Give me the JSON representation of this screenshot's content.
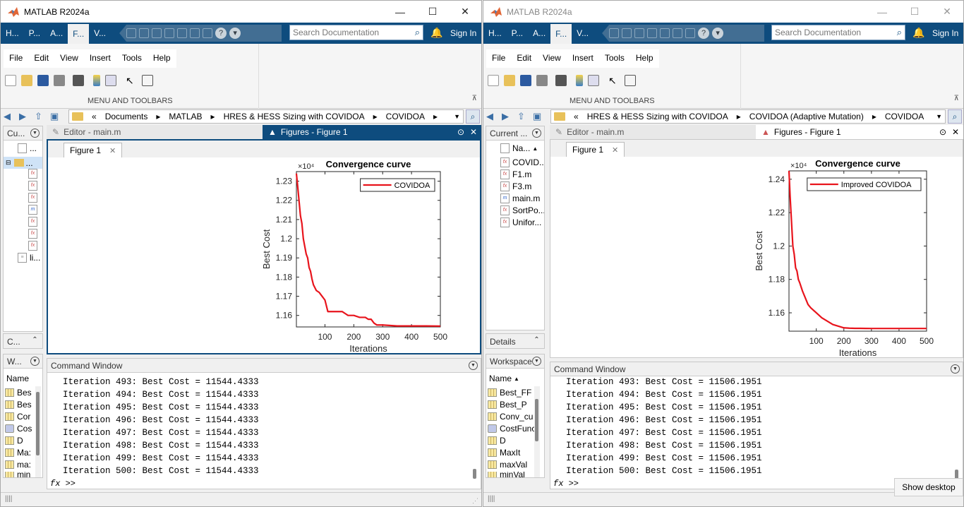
{
  "left": {
    "title": "MATLAB R2024a",
    "ribbon_tabs": [
      "H...",
      "P...",
      "A...",
      "F...",
      "V..."
    ],
    "active_tab": 3,
    "search_placeholder": "Search Documentation",
    "sign_in": "Sign In",
    "menus": [
      "File",
      "Edit",
      "View",
      "Insert",
      "Tools",
      "Help"
    ],
    "section_label": "MENU AND TOOLBARS",
    "path": [
      "«",
      "Documents",
      "▸",
      "MATLAB",
      "▸",
      "HRES & HESS Sizing with COVIDOA",
      "▸",
      "COVIDOA",
      "▸"
    ],
    "current_folder_header": "Cu...",
    "current_folder_items": [
      "...",
      "..."
    ],
    "current_folder_file": "li...",
    "collapsed_header": "C...",
    "workspace_header": "W...",
    "workspace_col": "Name",
    "workspace_items": [
      "Bes",
      "Bes",
      "Cor",
      "Cos",
      "D",
      "Ma:",
      "ma:",
      "min"
    ],
    "editor_tab": "Editor - main.m",
    "figures_tab": "Figures - Figure 1",
    "figure_subtab": "Figure 1",
    "command_header": "Command Window",
    "command_lines": [
      "Iteration 493: Best Cost = 11544.4333",
      "Iteration 494: Best Cost = 11544.4333",
      "Iteration 495: Best Cost = 11544.4333",
      "Iteration 496: Best Cost = 11544.4333",
      "Iteration 497: Best Cost = 11544.4333",
      "Iteration 498: Best Cost = 11544.4333",
      "Iteration 499: Best Cost = 11544.4333",
      "Iteration 500: Best Cost = 11544.4333"
    ],
    "prompt_fx": "fx",
    "prompt": ">>"
  },
  "right": {
    "title": "MATLAB R2024a",
    "ribbon_tabs": [
      "H...",
      "P...",
      "A...",
      "F...",
      "V..."
    ],
    "active_tab": 3,
    "search_placeholder": "Search Documentation",
    "sign_in": "Sign In",
    "menus": [
      "File",
      "Edit",
      "View",
      "Insert",
      "Tools",
      "Help"
    ],
    "section_label": "MENU AND TOOLBARS",
    "path": [
      "«",
      "HRES & HESS Sizing with COVIDOA",
      "▸",
      "COVIDOA (Adaptive Mutation)",
      "▸",
      "COVIDOA"
    ],
    "current_folder_header": "Current ...",
    "current_folder_col": "Na...",
    "current_folder_items": [
      "COVID...",
      "F1.m",
      "F3.m",
      "main.m",
      "SortPo...",
      "Unifor..."
    ],
    "details_header": "Details",
    "workspace_header": "Workspace",
    "workspace_col": "Name",
    "workspace_items": [
      "Best_FF",
      "Best_P",
      "Conv_cu",
      "CostFunc",
      "D",
      "MaxIt",
      "maxVal",
      "minVal"
    ],
    "editor_tab": "Editor - main.m",
    "figures_tab": "Figures - Figure 1",
    "figure_subtab": "Figure 1",
    "command_header": "Command Window",
    "command_lines": [
      "Iteration 493: Best Cost = 11506.1951",
      "Iteration 494: Best Cost = 11506.1951",
      "Iteration 495: Best Cost = 11506.1951",
      "Iteration 496: Best Cost = 11506.1951",
      "Iteration 497: Best Cost = 11506.1951",
      "Iteration 498: Best Cost = 11506.1951",
      "Iteration 499: Best Cost = 11506.1951",
      "Iteration 500: Best Cost = 11506.1951"
    ],
    "prompt_fx": "fx",
    "prompt": ">>",
    "show_desktop": "Show desktop"
  },
  "chart_data": [
    {
      "type": "line",
      "title": "Convergence curve",
      "xlabel": "Iterations",
      "ylabel": "Best Cost",
      "exponent_label": "×10⁴",
      "xlim": [
        1,
        500
      ],
      "ylim": [
        11540,
        12350
      ],
      "xticks": [
        100,
        200,
        300,
        400,
        500
      ],
      "yticks": [
        1.16,
        1.17,
        1.18,
        1.19,
        1.2,
        1.21,
        1.22,
        1.23
      ],
      "ytick_labels": [
        "1.16",
        "1.17",
        "1.18",
        "1.19",
        "1.2",
        "1.21",
        "1.22",
        "1.23"
      ],
      "legend": "top-right",
      "series": [
        {
          "name": "COVIDOA",
          "color": "#e8141c",
          "x": [
            1,
            5,
            10,
            15,
            20,
            25,
            30,
            35,
            40,
            45,
            50,
            55,
            60,
            70,
            80,
            90,
            95,
            100,
            110,
            120,
            140,
            160,
            170,
            180,
            200,
            220,
            240,
            250,
            260,
            270,
            280,
            300,
            350,
            400,
            450,
            500
          ],
          "y": [
            12340,
            12280,
            12200,
            12120,
            12080,
            12000,
            11960,
            11920,
            11900,
            11850,
            11830,
            11790,
            11760,
            11730,
            11720,
            11700,
            11690,
            11680,
            11620,
            11620,
            11620,
            11620,
            11610,
            11600,
            11600,
            11590,
            11590,
            11580,
            11580,
            11560,
            11550,
            11550,
            11545,
            11545,
            11545,
            11544.4
          ]
        }
      ]
    },
    {
      "type": "line",
      "title": "Convergence curve",
      "xlabel": "Iterations",
      "ylabel": "Best Cost",
      "exponent_label": "×10⁴",
      "xlim": [
        1,
        500
      ],
      "ylim": [
        11490,
        12450
      ],
      "xticks": [
        100,
        200,
        300,
        400,
        500
      ],
      "yticks": [
        1.16,
        1.18,
        1.2,
        1.22,
        1.24
      ],
      "ytick_labels": [
        "1.16",
        "1.18",
        "1.2",
        "1.22",
        "1.24"
      ],
      "legend": "top-right",
      "series": [
        {
          "name": "Improved COVIDOA",
          "color": "#e8141c",
          "x": [
            1,
            5,
            10,
            15,
            20,
            25,
            30,
            35,
            40,
            50,
            60,
            70,
            80,
            100,
            120,
            140,
            160,
            180,
            200,
            220,
            240,
            260,
            280,
            300,
            350,
            400,
            450,
            500
          ],
          "y": [
            12450,
            12300,
            12150,
            12000,
            11950,
            11870,
            11850,
            11800,
            11780,
            11730,
            11690,
            11650,
            11630,
            11600,
            11570,
            11550,
            11530,
            11520,
            11510,
            11508,
            11507,
            11507,
            11506.5,
            11506.2,
            11506.2,
            11506.2,
            11506.2,
            11506.2
          ]
        }
      ]
    }
  ]
}
